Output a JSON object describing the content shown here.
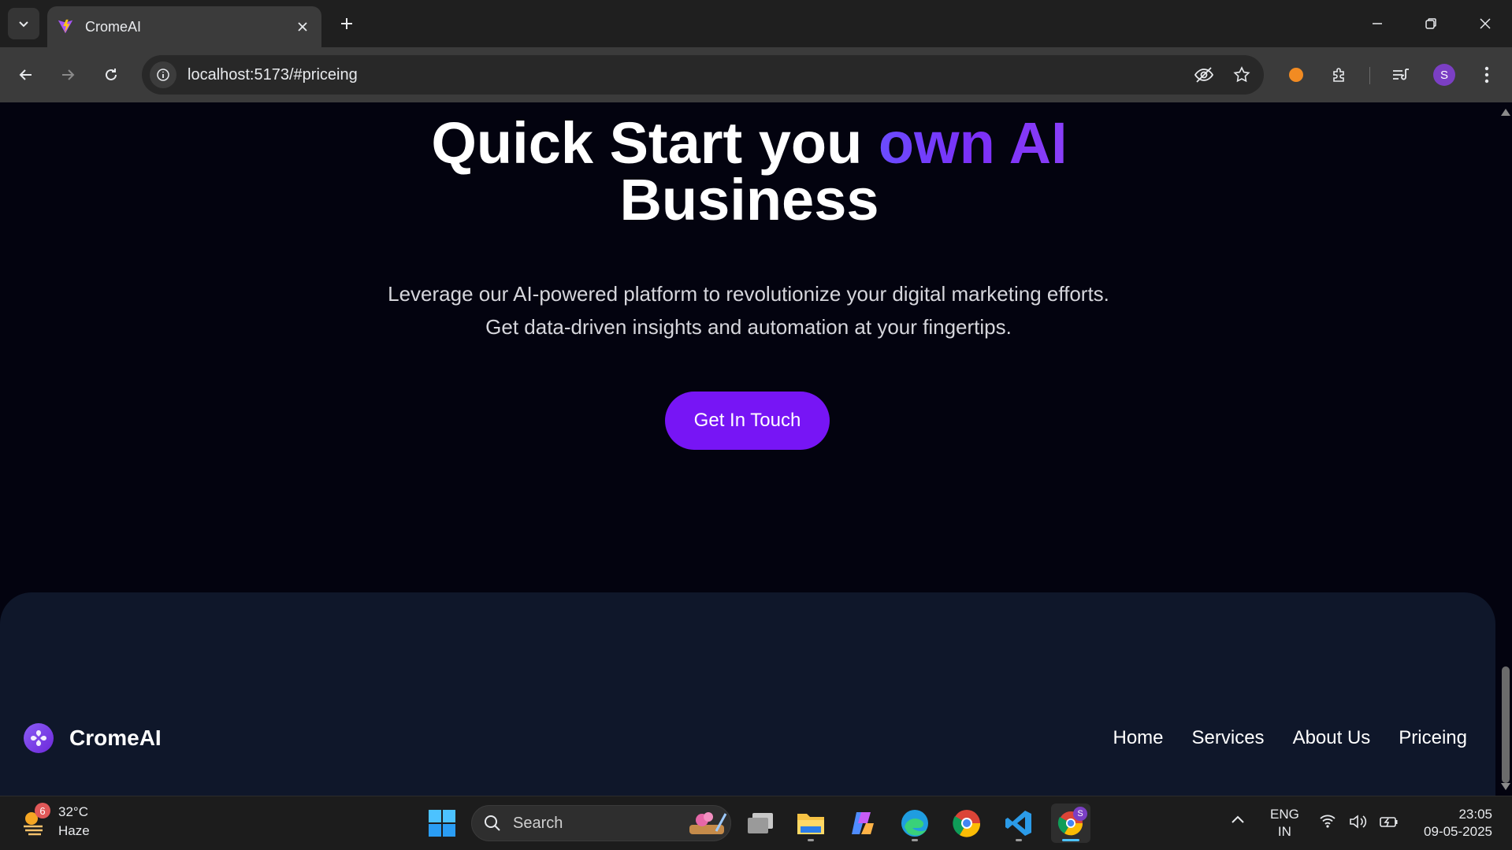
{
  "browser": {
    "tab_title": "CromeAI",
    "url": "localhost:5173/#priceing",
    "profile_initial": "S"
  },
  "hero": {
    "title_part1": "Quick Start you ",
    "title_accent": "own AI",
    "title_part2": "Business",
    "subtitle": "Leverage our AI-powered platform to revolutionize your digital marketing efforts. Get data-driven insights and automation at your fingertips.",
    "cta_label": "Get In Touch"
  },
  "footer": {
    "brand": "CromeAI",
    "nav": [
      "Home",
      "Services",
      "About Us",
      "Priceing"
    ]
  },
  "taskbar": {
    "weather_temp": "32°C",
    "weather_desc": "Haze",
    "weather_badge": "6",
    "search_label": "Search",
    "lang_line1": "ENG",
    "lang_line2": "IN",
    "time": "23:05",
    "date": "09-05-2025",
    "chrome_badge": "S"
  },
  "colors": {
    "accent": "#7715f5",
    "page_bg": "#03030f",
    "footer_bg": "#0f172a"
  }
}
